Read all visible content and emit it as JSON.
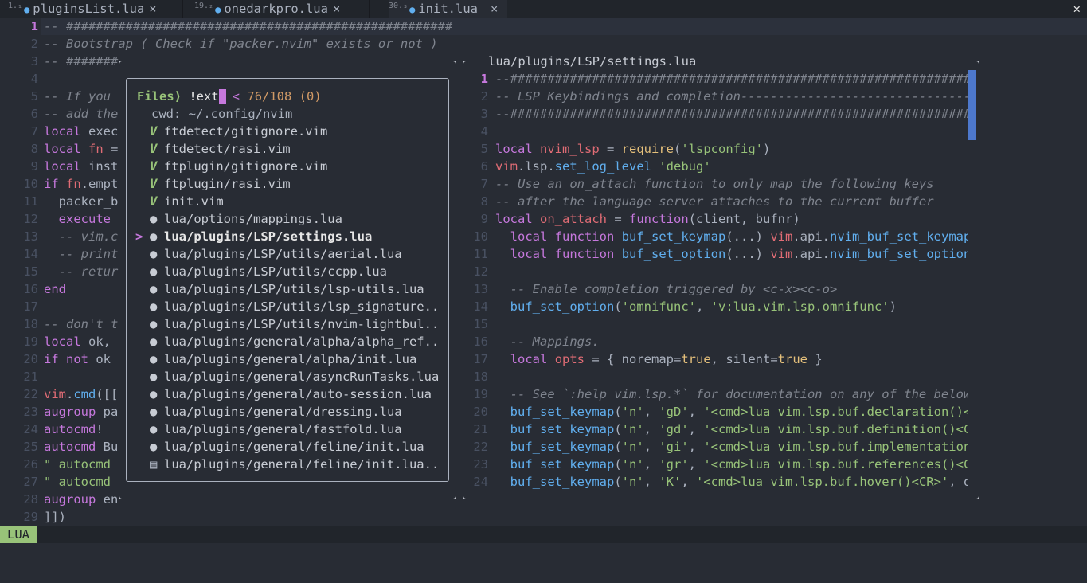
{
  "tabs": [
    {
      "num": "1.₁",
      "name": "pluginsList.lua",
      "close": "×"
    },
    {
      "num": "19.₂",
      "name": "onedarkpro.lua",
      "close": "×"
    },
    {
      "num": "30.₃",
      "name": "init.lua",
      "close": "×"
    }
  ],
  "close_all": "✕",
  "editor": {
    "lines": [
      {
        "n": "1",
        "code": "-- ####################################################"
      },
      {
        "n": "2",
        "code": "-- Bootstrap ( Check if \"packer.nvim\" exists or not )"
      },
      {
        "n": "3",
        "code": "-- #######"
      },
      {
        "n": "4",
        "code": ""
      },
      {
        "n": "5",
        "code": "-- If you"
      },
      {
        "n": "6",
        "code": "-- add the"
      },
      {
        "n": "7",
        "code": "local exec"
      },
      {
        "n": "8",
        "code": "local fn ="
      },
      {
        "n": "9",
        "code": "local inst"
      },
      {
        "n": "10",
        "code": "if fn.empt"
      },
      {
        "n": "11",
        "code": "  packer_b"
      },
      {
        "n": "12",
        "code": "  execute"
      },
      {
        "n": "13",
        "code": "  -- vim.c"
      },
      {
        "n": "14",
        "code": "  -- print"
      },
      {
        "n": "15",
        "code": "  -- retur"
      },
      {
        "n": "16",
        "code": "end"
      },
      {
        "n": "17",
        "code": ""
      },
      {
        "n": "18",
        "code": "-- don't t"
      },
      {
        "n": "19",
        "code": "local ok,"
      },
      {
        "n": "20",
        "code": "if not ok"
      },
      {
        "n": "21",
        "code": ""
      },
      {
        "n": "22",
        "code": "vim.cmd([["
      },
      {
        "n": "23",
        "code": "augroup pa"
      },
      {
        "n": "24",
        "code": "autocmd!"
      },
      {
        "n": "25",
        "code": "autocmd Bu"
      },
      {
        "n": "26",
        "code": "\" autocmd"
      },
      {
        "n": "27",
        "code": "\" autocmd"
      },
      {
        "n": "28",
        "code": "augroup en"
      },
      {
        "n": "29",
        "code": "]])"
      }
    ]
  },
  "statusline": {
    "mode": "LUA"
  },
  "picker": {
    "label": "Files⟩",
    "query": "!ext",
    "sep": "<",
    "count": "76/108 (0)",
    "cwd": "cwd: ~/.config/nvim",
    "items": [
      {
        "icon": "vim",
        "name": "ftdetect/gitignore.vim"
      },
      {
        "icon": "vim",
        "name": "ftdetect/rasi.vim"
      },
      {
        "icon": "vim",
        "name": "ftplugin/gitignore.vim"
      },
      {
        "icon": "vim",
        "name": "ftplugin/rasi.vim"
      },
      {
        "icon": "vim",
        "name": "init.vim"
      },
      {
        "icon": "lua",
        "name": "lua/options/mappings.lua"
      },
      {
        "icon": "lua",
        "name": "lua/plugins/LSP/settings.lua",
        "selected": true
      },
      {
        "icon": "lua",
        "name": "lua/plugins/LSP/utils/aerial.lua"
      },
      {
        "icon": "lua",
        "name": "lua/plugins/LSP/utils/ccpp.lua"
      },
      {
        "icon": "lua",
        "name": "lua/plugins/LSP/utils/lsp-utils.lua"
      },
      {
        "icon": "lua",
        "name": "lua/plugins/LSP/utils/lsp_signature.."
      },
      {
        "icon": "lua",
        "name": "lua/plugins/LSP/utils/nvim-lightbul.."
      },
      {
        "icon": "lua",
        "name": "lua/plugins/general/alpha/alpha_ref.."
      },
      {
        "icon": "lua",
        "name": "lua/plugins/general/alpha/init.lua"
      },
      {
        "icon": "lua",
        "name": "lua/plugins/general/asyncRunTasks.lua"
      },
      {
        "icon": "lua",
        "name": "lua/plugins/general/auto-session.lua"
      },
      {
        "icon": "lua",
        "name": "lua/plugins/general/dressing.lua"
      },
      {
        "icon": "lua",
        "name": "lua/plugins/general/fastfold.lua"
      },
      {
        "icon": "lua",
        "name": "lua/plugins/general/feline/init.lua"
      },
      {
        "icon": "file",
        "name": "lua/plugins/general/feline/init.lua.."
      }
    ],
    "selected_marker": ">"
  },
  "preview": {
    "title": "lua/plugins/LSP/settings.lua",
    "lines": [
      {
        "n": "1",
        "code": "--####################################################################"
      },
      {
        "n": "2",
        "code": "-- LSP Keybindings and completion--------------------------------------"
      },
      {
        "n": "3",
        "code": "--####################################################################"
      },
      {
        "n": "4",
        "code": ""
      },
      {
        "n": "5",
        "code": "local nvim_lsp = require('lspconfig')"
      },
      {
        "n": "6",
        "code": "vim.lsp.set_log_level 'debug'"
      },
      {
        "n": "7",
        "code": "-- Use an on_attach function to only map the following keys"
      },
      {
        "n": "8",
        "code": "-- after the language server attaches to the current buffer"
      },
      {
        "n": "9",
        "code": "local on_attach = function(client, bufnr)"
      },
      {
        "n": "10",
        "code": "  local function buf_set_keymap(...) vim.api.nvim_buf_set_keymap(b"
      },
      {
        "n": "11",
        "code": "  local function buf_set_option(...) vim.api.nvim_buf_set_option(b"
      },
      {
        "n": "12",
        "code": ""
      },
      {
        "n": "13",
        "code": "  -- Enable completion triggered by <c-x><c-o>"
      },
      {
        "n": "14",
        "code": "  buf_set_option('omnifunc', 'v:lua.vim.lsp.omnifunc')"
      },
      {
        "n": "15",
        "code": ""
      },
      {
        "n": "16",
        "code": "  -- Mappings."
      },
      {
        "n": "17",
        "code": "  local opts = { noremap=true, silent=true }"
      },
      {
        "n": "18",
        "code": ""
      },
      {
        "n": "19",
        "code": "  -- See `:help vim.lsp.*` for documentation on any of the below f"
      },
      {
        "n": "20",
        "code": "  buf_set_keymap('n', 'gD', '<cmd>lua vim.lsp.buf.declaration()<CR"
      },
      {
        "n": "21",
        "code": "  buf_set_keymap('n', 'gd', '<cmd>lua vim.lsp.buf.definition()<CR>"
      },
      {
        "n": "22",
        "code": "  buf_set_keymap('n', 'gi', '<cmd>lua vim.lsp.buf.implementation()"
      },
      {
        "n": "23",
        "code": "  buf_set_keymap('n', 'gr', '<cmd>lua vim.lsp.buf.references()<CR>"
      },
      {
        "n": "24",
        "code": "  buf_set_keymap('n', 'K', '<cmd>lua vim.lsp.buf.hover()<CR>', opt"
      }
    ]
  },
  "colors": {
    "background": "#282c34",
    "keyword": "#c678dd",
    "function": "#61afef",
    "string": "#98c379",
    "comment": "#7f848e",
    "mode_bg": "#98c379"
  }
}
